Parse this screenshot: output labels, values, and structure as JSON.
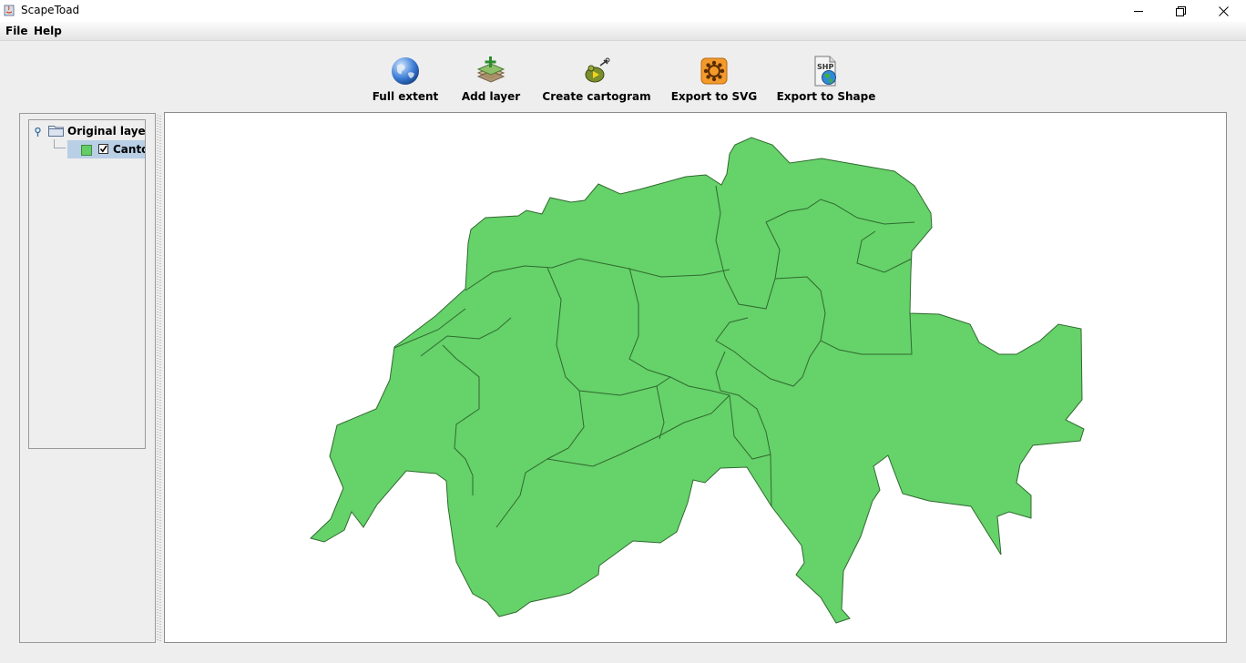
{
  "window": {
    "title": "ScapeToad"
  },
  "menu": {
    "items": [
      "File",
      "Help"
    ]
  },
  "toolbar": {
    "full_extent": "Full extent",
    "add_layer": "Add layer",
    "create_cartogram": "Create cartogram",
    "export_svg": "Export to SVG",
    "export_shape": "Export to Shape",
    "shp_badge": "SHP"
  },
  "layers": {
    "root_label": "Original layers",
    "child_label": "Canto",
    "child_checked": true,
    "child_color": "#66cc66"
  },
  "map": {
    "fill": "#66d26a",
    "stroke": "#2f6a2f"
  }
}
